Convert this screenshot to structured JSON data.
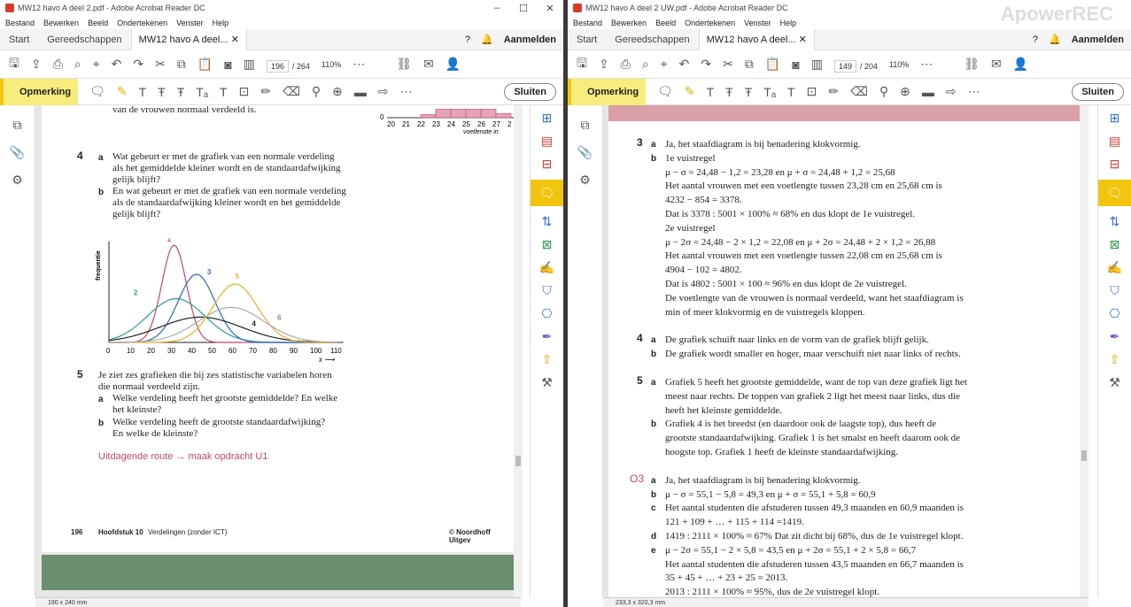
{
  "left": {
    "title": "MW12 havo A deel 2.pdf - Adobe Acrobat Reader DC",
    "menu": [
      "Bestand",
      "Bewerken",
      "Beeld",
      "Ondertekenen",
      "Venster",
      "Help"
    ],
    "tabs": {
      "start": "Start",
      "tools": "Gereedschappen",
      "doc": "MW12 havo A deel..."
    },
    "login": "Aanmelden",
    "page_current": "196",
    "page_total": "/ 264",
    "zoom": "110%",
    "annot_label": "Opmerking",
    "close_label": "Sluiten",
    "status": "190 x 240 mm",
    "content": {
      "top_line": "van de vrouwen normaal verdeeld is.",
      "hist_ticks": [
        "20",
        "21",
        "22",
        "23",
        "24",
        "25",
        "26",
        "27",
        "2"
      ],
      "hist_zero": "0",
      "hist_xlabel": "voetlengte in",
      "q4_num": "4",
      "q4a_let": "a",
      "q4a": [
        "Wat gebeurt er met de grafiek van een normale verdeling",
        "als het gemiddelde kleiner wordt en de standaardafwijking",
        "gelijk blijft?"
      ],
      "q4b_let": "b",
      "q4b": [
        "En wat gebeurt er met de grafiek van een normale verdeling",
        "als de standaardafwijking kleiner wordt en het gemiddelde",
        "gelijk blijft?"
      ],
      "graph_ylabel": "frequentie",
      "graph_xlabel": "x",
      "graph_ticks": [
        "0",
        "10",
        "20",
        "30",
        "40",
        "50",
        "60",
        "70",
        "80",
        "90",
        "100",
        "110"
      ],
      "curve_labels": [
        "1",
        "2",
        "3",
        "4",
        "5",
        "6"
      ],
      "q5_num": "5",
      "q5": [
        "Je ziet zes grafieken die bij zes statistische variabelen horen",
        "die normaal verdeeld zijn."
      ],
      "q5a_let": "a",
      "q5a": [
        "Welke verdeling heeft het grootste gemiddelde? En welke",
        "het kleinste?"
      ],
      "q5b_let": "b",
      "q5b": [
        "Welke verdeling heeft de grootste standaardafwijking?",
        "En welke de kleinste?"
      ],
      "route": "Uitdagende route → maak opdracht U1",
      "footer_page": "196",
      "footer_chapter": "Hoofdstuk 10",
      "footer_title": "Verdelingen (zonder ICT)",
      "footer_pub": "© Noordhoff Uitgev"
    }
  },
  "right": {
    "title": "MW12 havo A deel 2 UW.pdf - Adobe Acrobat Reader DC",
    "watermark": "ApowerREC",
    "menu": [
      "Bestand",
      "Bewerken",
      "Beeld",
      "Ondertekenen",
      "Venster",
      "Help"
    ],
    "tabs": {
      "start": "Start",
      "tools": "Gereedschappen",
      "doc": "MW12 havo A deel..."
    },
    "login": "Aanmelden",
    "page_current": "149",
    "page_total": "/ 204",
    "zoom": "110%",
    "annot_label": "Opmerking",
    "close_label": "Sluiten",
    "status": "233,3 x 320,3 mm",
    "content": {
      "a3_num": "3",
      "a3": [
        {
          "l": "a",
          "t": "Ja, het staafdiagram is bij benadering klokvormig."
        },
        {
          "l": "b",
          "t": "1e vuistregel"
        },
        {
          "l": "",
          "t": "μ − σ = 24,48 − 1,2 = 23,28 en μ + σ = 24,48 + 1,2 = 25,68"
        },
        {
          "l": "",
          "t": "Het aantal vrouwen met een voetlengte tussen 23,28 cm en 25,68 cm is"
        },
        {
          "l": "",
          "t": "4232 − 854 = 3378."
        },
        {
          "l": "",
          "t": "Dat is 3378 : 5001 × 100% ≈ 68% en dus klopt de 1e vuistregel."
        },
        {
          "l": "",
          "t": "2e vuistregel"
        },
        {
          "l": "",
          "t": "μ − 2σ = 24,48 − 2 × 1,2 = 22,08 en μ + 2σ = 24,48 + 2 × 1,2 = 26,88"
        },
        {
          "l": "",
          "t": "Het aantal vrouwen met een voetlengte tussen 22,08 cm en 25,68 cm is"
        },
        {
          "l": "",
          "t": "4904 − 102 = 4802."
        },
        {
          "l": "",
          "t": "Dat is 4802 : 5001 × 100 ≈ 96% en dus klopt de 2e vuistregel."
        },
        {
          "l": "",
          "t": "De voetlengte van de vrouwen is normaal verdeeld, want het staafdiagram is"
        },
        {
          "l": "",
          "t": "min of meer klokvormig en de vuistregels kloppen."
        }
      ],
      "a4_num": "4",
      "a4": [
        {
          "l": "a",
          "t": "De grafiek schuift naar links en de vorm van de grafiek blijft gelijk."
        },
        {
          "l": "b",
          "t": "De grafiek wordt smaller en hoger, maar verschuift niet naar links of rechts."
        }
      ],
      "a5_num": "5",
      "a5": [
        {
          "l": "a",
          "t": "Grafiek 5 heeft het grootste gemiddelde, want de top van deze grafiek ligt het"
        },
        {
          "l": "",
          "t": "meest naar rechts. De toppen van grafiek 2 ligt het meest naar links, dus die"
        },
        {
          "l": "",
          "t": "heeft het kleinste gemiddelde."
        },
        {
          "l": "b",
          "t": "Grafiek 4 is het breedst (en daardoor ook de laagste top), dus heeft de"
        },
        {
          "l": "",
          "t": "grootste standaardafwijking. Grafiek 1 is het smalst en heeft daarom ook de"
        },
        {
          "l": "",
          "t": "hoogste top. Grafiek 1 heeft de kleinste standaardafwijking."
        }
      ],
      "o3_num": "O3",
      "o3": [
        {
          "l": "a",
          "t": "Ja, het staafdiagram is bij benadering klokvormig."
        },
        {
          "l": "b",
          "t": "μ − σ = 55,1 − 5,8 = 49,3 en μ + σ = 55,1 + 5,8 = 60,9"
        },
        {
          "l": "c",
          "t": "Het aantal studenten die afstuderen tussen 49,3 maanden en 60,9 maanden is"
        },
        {
          "l": "",
          "t": "121 + 109 + … + 115 + 114 =1419."
        },
        {
          "l": "d",
          "t": "1419 : 2111 × 100% ≈ 67% Dat zit dicht bij 68%, dus de 1e vuistregel klopt."
        },
        {
          "l": "e",
          "t": "μ − 2σ = 55,1 − 2 × 5,8 = 43,5 en μ + 2σ = 55,1 + 2 × 5,8 = 66,7"
        },
        {
          "l": "",
          "t": "Het aantal studenten die afstuderen tussen 43,5 maanden en 66,7 maanden is"
        },
        {
          "l": "",
          "t": "35 + 45 + … + 23 + 25 = 2013."
        },
        {
          "l": "",
          "t": "2013 : 2111 × 100% ≈ 95%, dus de 2e vuistregel klopt."
        }
      ]
    }
  },
  "colors": {
    "accent": "#f2c40f",
    "route": "#c0486a",
    "banner": "#d9a0a8",
    "green": "#6b8f6e",
    "hist": "#e8a3b3"
  }
}
